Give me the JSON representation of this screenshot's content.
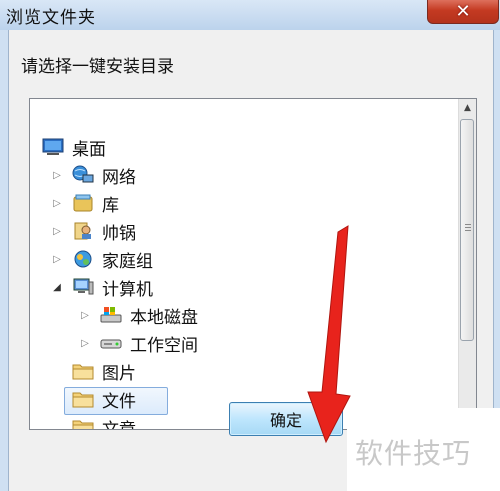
{
  "window": {
    "title": "浏览文件夹",
    "close_glyph": "✕"
  },
  "dialog": {
    "instruction": "请选择一键安装目录",
    "ok_label": "确定"
  },
  "tree": {
    "items": [
      {
        "label": "桌面",
        "icon": "desktop-icon",
        "expander": "",
        "level": 0
      },
      {
        "label": "网络",
        "icon": "network-icon",
        "expander": "▷",
        "level": 1
      },
      {
        "label": "库",
        "icon": "library-icon",
        "expander": "▷",
        "level": 1
      },
      {
        "label": "帅锅",
        "icon": "user-folder-icon",
        "expander": "▷",
        "level": 1
      },
      {
        "label": "家庭组",
        "icon": "homegroup-icon",
        "expander": "▷",
        "level": 1
      },
      {
        "label": "计算机",
        "icon": "computer-icon",
        "expander": "◢",
        "level": 1
      },
      {
        "label": "本地磁盘",
        "icon": "local-disk-icon",
        "expander": "▷",
        "level": 2
      },
      {
        "label": "工作空间",
        "icon": "drive-icon",
        "expander": "▷",
        "level": 2
      },
      {
        "label": "图片",
        "icon": "folder-icon",
        "expander": "",
        "level": 1
      },
      {
        "label": "文件",
        "icon": "folder-icon",
        "expander": "",
        "level": 1,
        "selected": true
      },
      {
        "label": "文章",
        "icon": "folder-icon",
        "expander": "",
        "level": 1
      }
    ]
  },
  "scrollbar": {
    "up_glyph": "▲",
    "down_glyph": "▼"
  },
  "watermark": {
    "text": "软件技巧"
  },
  "colors": {
    "close_button": "#c43a22",
    "selection": "#dcebfc",
    "annotation_arrow": "#e8231c",
    "ok_button": "#bee6fd"
  }
}
